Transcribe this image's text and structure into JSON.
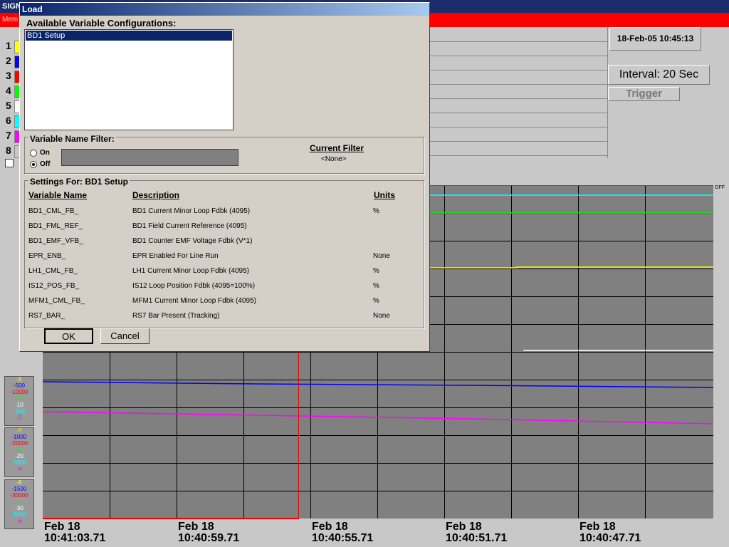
{
  "app": {
    "title_fragment": "SIGN",
    "menu_fragment": "Mem"
  },
  "channels": [
    "1",
    "2",
    "3",
    "4",
    "5",
    "6",
    "7",
    "8"
  ],
  "channel_colors": [
    "#ffff00",
    "#0000ff",
    "#ff0000",
    "#00ff00",
    "#ffffff",
    "#00ffff",
    "#ff00ff",
    "#c8c8c8"
  ],
  "header": {
    "datetime": "18-Feb-05 10:45:13",
    "interval": "Interval:  20 Sec",
    "trigger": "Trigger"
  },
  "chart": {
    "off_label": "OFF",
    "time_labels": [
      {
        "date": "Feb 18",
        "time": "10:41:03.71"
      },
      {
        "date": "Feb 18",
        "time": "10:40:59.71"
      },
      {
        "date": "Feb 18",
        "time": "10:40:55.71"
      },
      {
        "date": "Feb 18",
        "time": "10:40:51.71"
      },
      {
        "date": "Feb 18",
        "time": "10:40:47.71"
      }
    ],
    "panels": [
      [
        "-5",
        "-500",
        "-10000",
        "-2",
        "-10",
        "-300",
        "-2"
      ],
      [
        "-7",
        "-1000",
        "-20000",
        "-4",
        "-20",
        "-3000",
        "-4"
      ],
      [
        "-8",
        "-1500",
        "-30000",
        "-6",
        "-30",
        "-5000",
        "-6"
      ]
    ]
  },
  "dialog": {
    "title": "Load",
    "available_label": "Available  Variable Configurations:",
    "configs": [
      "BD1 Setup"
    ],
    "filter_label": "Variable Name Filter:",
    "on_label": "On",
    "off_label": "Off",
    "current_filter_label": "Current Filter",
    "current_filter_value": "<None>",
    "settings_label": "Settings For:  BD1 Setup",
    "columns": {
      "name": "Variable Name",
      "desc": "Description",
      "units": "Units"
    },
    "rows": [
      {
        "name": "BD1_CML_FB_",
        "desc": "BD1 Current Minor Loop Fdbk (4095)",
        "units": "%"
      },
      {
        "name": "BD1_FML_REF_",
        "desc": "BD1 Field Current Reference (4095)",
        "units": ""
      },
      {
        "name": "BD1_EMF_VFB_",
        "desc": "BD1 Counter EMF Voltage Fdbk (V*1)",
        "units": ""
      },
      {
        "name": "EPR_ENB_",
        "desc": "EPR Enabled For Line Run",
        "units": "None"
      },
      {
        "name": "LH1_CML_FB_",
        "desc": "LH1 Current Minor Loop Fdbk (4095)",
        "units": "%"
      },
      {
        "name": "IS12_POS_FB_",
        "desc": "IS12 Loop Position Fdbk (4095=100%)",
        "units": "%"
      },
      {
        "name": "MFM1_CML_FB_",
        "desc": "MFM1 Current Minor Loop Fdbk (4095)",
        "units": "%"
      },
      {
        "name": "RS7_BAR_",
        "desc": "RS7 Bar Present (Tracking)",
        "units": "None"
      }
    ],
    "ok_label": "OK",
    "cancel_label": "Cancel"
  }
}
